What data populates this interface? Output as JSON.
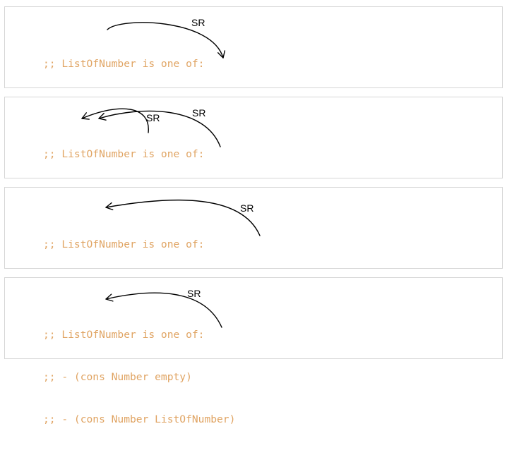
{
  "code_lines": [
    ";; ListOfNumber is one of:",
    ";; - (cons Number empty)",
    ";; - (cons Number ListOfNumber)"
  ],
  "annotation_label": "SR",
  "colors": {
    "code_text": "#e0a463",
    "panel_border": "#d6d6d6",
    "arrow": "#000000"
  }
}
